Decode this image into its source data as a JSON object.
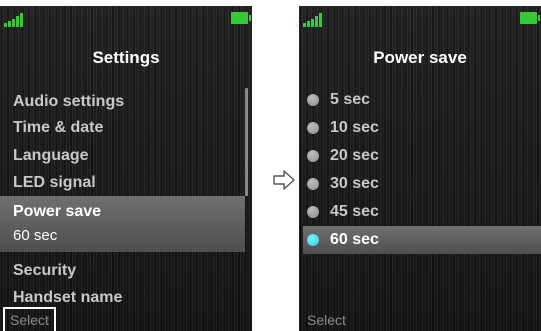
{
  "left_screen": {
    "title": "Settings",
    "items": [
      {
        "label": "Audio settings"
      },
      {
        "label": "Time & date"
      },
      {
        "label": "Language"
      },
      {
        "label": "LED signal"
      },
      {
        "label": "Power save",
        "value": "60 sec",
        "selected": true
      },
      {
        "label": "Security"
      },
      {
        "label": "Handset name"
      }
    ],
    "softkey_left": "Select",
    "icons": {
      "signal": "signal-strength-icon",
      "battery": "battery-full-icon",
      "scroll": "scrollbar"
    }
  },
  "right_screen": {
    "title": "Power save",
    "options": [
      {
        "label": "5 sec",
        "selected": false
      },
      {
        "label": "10 sec",
        "selected": false
      },
      {
        "label": "20 sec",
        "selected": false
      },
      {
        "label": "30 sec",
        "selected": false
      },
      {
        "label": "45 sec",
        "selected": false
      },
      {
        "label": "60 sec",
        "selected": true
      }
    ],
    "softkey_left": "Select",
    "icons": {
      "signal": "signal-strength-icon",
      "battery": "battery-full-icon",
      "radio": "radio-button-icon"
    }
  },
  "transition_icon": "right-arrow-icon",
  "colors": {
    "screen_background": "#1c1c1c",
    "text": "#c8c8c8",
    "highlight": "#5e5e5e",
    "status_green": "#38c838",
    "radio_selected": "#2cc7e0"
  }
}
